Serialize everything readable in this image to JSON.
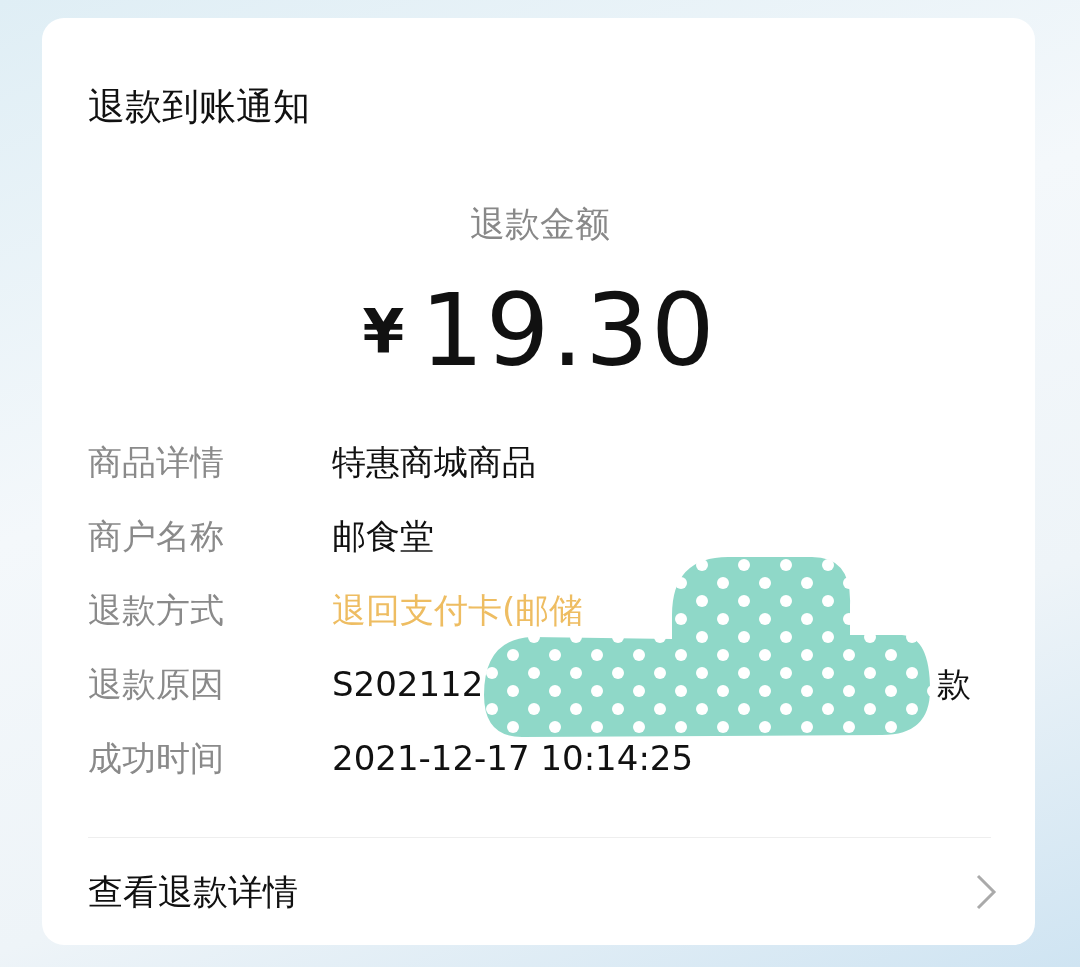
{
  "card": {
    "title": "退款到账通知",
    "amount_label": "退款金额",
    "amount": {
      "currency": "¥",
      "value": "19.30"
    },
    "details": [
      {
        "kind": "plain",
        "label": "商品详情",
        "value": "特惠商城商品"
      },
      {
        "kind": "plain",
        "label": "商户名称",
        "value": "邮食堂"
      },
      {
        "kind": "highlight",
        "label": "退款方式",
        "value": "退回支付卡(邮储"
      },
      {
        "kind": "split",
        "label": "退款原因",
        "value": "S202112",
        "value_end": "款"
      },
      {
        "kind": "plain",
        "label": "成功时间",
        "value": "2021-12-17 10:14:25"
      }
    ],
    "footer_link": "查看退款详情"
  }
}
